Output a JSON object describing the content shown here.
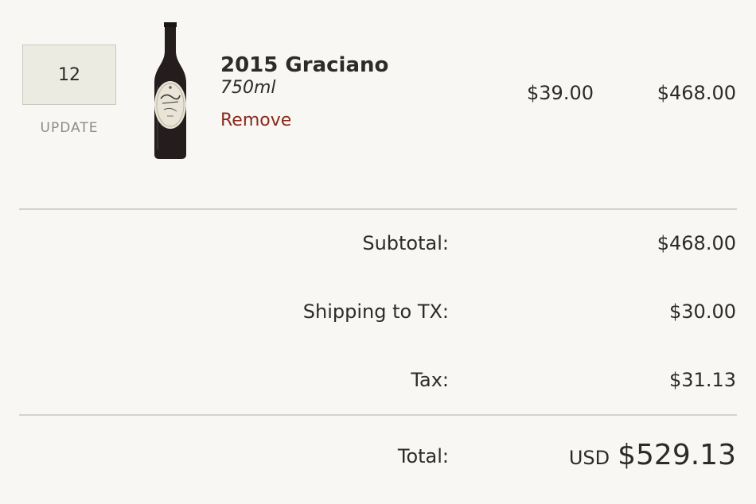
{
  "cart_item": {
    "quantity": "12",
    "update_label": "UPDATE",
    "name": "2015 Graciano",
    "size": "750ml",
    "remove_label": "Remove",
    "unit_price": "$39.00",
    "line_total": "$468.00",
    "bottle_icon": "wine-bottle-image"
  },
  "summary": {
    "subtotal_label": "Subtotal:",
    "subtotal_value": "$468.00",
    "shipping_label": "Shipping to TX:",
    "shipping_value": "$30.00",
    "tax_label": "Tax:",
    "tax_value": "$31.13",
    "total_label": "Total:",
    "currency": "USD",
    "total_value": "$529.13"
  },
  "colors": {
    "background": "#f8f7f3",
    "remove_link": "#8a2a1c",
    "input_bg": "#ecebe2"
  }
}
